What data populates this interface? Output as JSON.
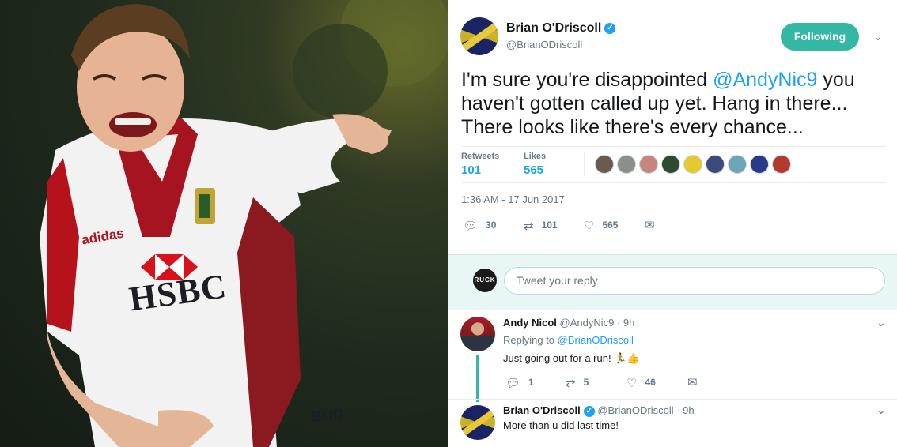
{
  "photo": {
    "sponsor_text": "HSBC",
    "kit_brand": "adidas",
    "shorts_initials": "BOD"
  },
  "tweet": {
    "author_name": "Brian O'Driscoll",
    "verified_glyph": "✓",
    "author_handle": "@BrianODriscoll",
    "follow_label": "Following",
    "text_part1": "I'm sure you're disappointed ",
    "mention": "@AndyNic9",
    "text_part2": " you haven't gotten called up yet. Hang in there... There looks like there's every chance...",
    "retweets_label": "Retweets",
    "retweets_count": "101",
    "likes_label": "Likes",
    "likes_count": "565",
    "timestamp": "1:36 AM - 17 Jun 2017",
    "actions": {
      "reply_count": "30",
      "retweet_count": "101",
      "like_count": "565"
    },
    "liker_colors": [
      "#6b5a4e",
      "#8a8f8a",
      "#c7867a",
      "#2e4a33",
      "#e5c92f",
      "#3b4a7a",
      "#6ea3b8",
      "#2a3a8a",
      "#b23a2e"
    ]
  },
  "reply_box": {
    "avatar_text": "RUCK",
    "placeholder": "Tweet your reply"
  },
  "replies": [
    {
      "name": "Andy Nicol",
      "handle": "@AndyNic9 · 9h",
      "replying_prefix": "Replying to",
      "replying_to": "@BrianODriscoll",
      "text": "Just going out for a run! 🏃👍",
      "reply_count": "1",
      "retweet_count": "5",
      "like_count": "46"
    },
    {
      "name": "Brian O'Driscoll",
      "handle": "@BrianODriscoll · 9h",
      "text": "More than u did last time!"
    }
  ],
  "icons": {
    "reply": "reply-icon",
    "retweet": "retweet-icon",
    "like": "heart-icon",
    "message": "envelope-icon",
    "caret": "chevron-down-icon"
  },
  "colors": {
    "accent": "#1da1f2",
    "follow_button": "#35b7a6",
    "reply_bar": "#e8f6f5"
  }
}
